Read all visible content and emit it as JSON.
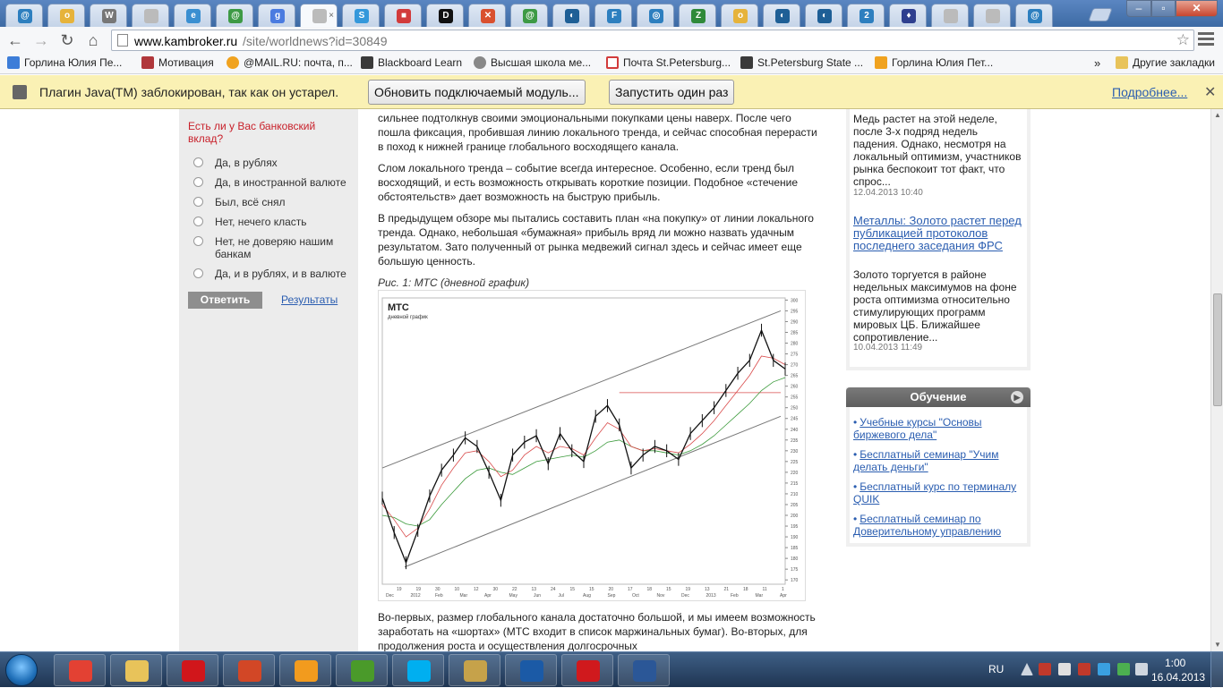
{
  "browser": {
    "url_host": "www.kambroker.ru",
    "url_path": "/site/worldnews?id=30849",
    "tabs": [
      {
        "icon": "tab-icon-1",
        "color": "#2d7fbf",
        "glyph": "@"
      },
      {
        "icon": "tab-icon-2",
        "color": "#e6b33b",
        "glyph": "o"
      },
      {
        "icon": "wikipedia-icon",
        "color": "#777",
        "glyph": "W"
      },
      {
        "icon": "page-icon",
        "color": "#bbb",
        "glyph": ""
      },
      {
        "icon": "tab-icon-5",
        "color": "#3a8fd1",
        "glyph": "e"
      },
      {
        "icon": "tab-icon-6",
        "color": "#3d9a45",
        "glyph": "@"
      },
      {
        "icon": "google-icon",
        "color": "#4a7be0",
        "glyph": "g"
      },
      {
        "icon": "page-icon-active",
        "color": "#bbb",
        "glyph": ""
      },
      {
        "icon": "tab-icon-9",
        "color": "#3498db",
        "glyph": "S"
      },
      {
        "icon": "tab-icon-10",
        "color": "#d23b3b",
        "glyph": "■"
      },
      {
        "icon": "tab-icon-11",
        "color": "#111",
        "glyph": "D"
      },
      {
        "icon": "tab-icon-12",
        "color": "#d9502f",
        "glyph": "✕"
      },
      {
        "icon": "tab-icon-13",
        "color": "#3d9a45",
        "glyph": "@"
      },
      {
        "icon": "tab-icon-14",
        "color": "#1e5f96",
        "glyph": "◐"
      },
      {
        "icon": "tab-icon-15",
        "color": "#2d7fbf",
        "glyph": "F"
      },
      {
        "icon": "tab-icon-16",
        "color": "#2d7fbf",
        "glyph": "◎"
      },
      {
        "icon": "tab-icon-17",
        "color": "#2f8a3a",
        "glyph": "Z"
      },
      {
        "icon": "tab-icon-18",
        "color": "#e6b33b",
        "glyph": "o"
      },
      {
        "icon": "tab-icon-19",
        "color": "#1e5f96",
        "glyph": "◐"
      },
      {
        "icon": "tab-icon-20",
        "color": "#1e5f96",
        "glyph": "◐"
      },
      {
        "icon": "tab-icon-21",
        "color": "#2d7fbf",
        "glyph": "2"
      },
      {
        "icon": "tab-icon-22",
        "color": "#2e3f8f",
        "glyph": "♦"
      },
      {
        "icon": "page-icon",
        "color": "#bbb",
        "glyph": ""
      },
      {
        "icon": "page-icon",
        "color": "#bbb",
        "glyph": ""
      },
      {
        "icon": "tab-icon-25",
        "color": "#2d7fbf",
        "glyph": "@"
      }
    ],
    "bookmarks": [
      {
        "label": "Горлина Юлия Пе...",
        "color": "#3d7dd8"
      },
      {
        "label": "Мотивация",
        "color": "#b0373b"
      },
      {
        "label": "@MAIL.RU: почта, п...",
        "color": "#f0a21f"
      },
      {
        "label": "Blackboard Learn",
        "color": "#3a3a3a"
      },
      {
        "label": "Высшая школа ме...",
        "color": "#888"
      },
      {
        "label": "Почта St.Petersburg...",
        "color": "#d23b3b"
      },
      {
        "label": "St.Petersburg State ...",
        "color": "#3a3a3a"
      },
      {
        "label": "Горлина Юлия Пет...",
        "color": "#f0a21f"
      }
    ],
    "bookmarks_overflow": "»",
    "other_bookmarks": "Другие закладки",
    "infobar": {
      "text": "Плагин Java(TM) заблокирован, так как он устарел.",
      "update_button": "Обновить подключаемый модуль...",
      "run_once_button": "Запустить один раз",
      "more_link": "Подробнее..."
    }
  },
  "poll": {
    "question": "Есть ли у Вас банковский вклад?",
    "options": [
      "Да, в рублях",
      "Да, в иностранной валюте",
      "Был, всё снял",
      "Нет, нечего класть",
      "Нет, не доверяю нашим банкам",
      "Да, и в рублях, и в валюте"
    ],
    "answer_button": "Ответить",
    "results_link": "Результаты"
  },
  "article": {
    "p0": "сильнее подтолкнув своими эмоциональными покупками цены наверх. После чего пошла фиксация, пробившая линию локального тренда, и сейчас способная перерасти в поход к нижней границе глобального восходящего канала.",
    "p1": "Слом локального тренда – событие всегда интересное. Особенно, если тренд был восходящий, и есть возможность открывать короткие позиции. Подобное «стечение обстоятельств» дает возможность на быструю прибыль.",
    "p2": "В предыдущем обзоре мы пытались составить план «на покупку» от линии локального тренда. Однако, небольшая «бумажная» прибыль вряд ли можно назвать удачным результатом. Зато полученный от рынка медвежий сигнал здесь и сейчас имеет еще большую ценность.",
    "figure_caption": "Рис. 1: МТС (дневной график)",
    "p3": "Во-первых, размер глобального канала достаточно большой, и мы имеем возможность заработать на «шортах» (МТС входит в список маржинальных бумаг). Во-вторых, для продолжения роста и осуществления долгосрочных"
  },
  "chart_data": {
    "type": "line",
    "title": "МТС",
    "subtitle": "дневной график",
    "y_ticks": [
      170,
      175,
      180,
      185,
      190,
      195,
      200,
      205,
      210,
      215,
      220,
      225,
      230,
      235,
      240,
      245,
      250,
      255,
      260,
      265,
      270,
      275,
      280,
      285,
      290,
      295,
      300
    ],
    "ylim": [
      168,
      301
    ],
    "x_tick_labels": [
      "19",
      "19",
      "30",
      "10",
      "12",
      "30",
      "22",
      "13",
      "24",
      "15",
      "15",
      "20",
      "17",
      "18",
      "15",
      "19",
      "13",
      "21",
      "18",
      "11",
      "1"
    ],
    "x_month_labels": [
      "Dec",
      "2012",
      "Feb",
      "Mar",
      "Apr",
      "May",
      "Jun",
      "Jul",
      "Aug",
      "Sep",
      "Oct",
      "Nov",
      "Dec",
      "2013",
      "Feb",
      "Mar",
      "Apr"
    ],
    "series": [
      {
        "values": [
          208,
          192,
          178,
          193,
          209,
          221,
          228,
          236,
          232,
          220,
          207,
          228,
          234,
          237,
          224,
          238,
          230,
          225,
          246,
          251,
          242,
          222,
          228,
          232,
          230,
          226,
          238,
          244,
          250,
          258,
          266,
          272,
          286,
          272,
          268
        ],
        "color": "#111"
      },
      {
        "values": [
          205,
          198,
          190,
          194,
          203,
          214,
          222,
          229,
          230,
          225,
          218,
          221,
          228,
          232,
          229,
          232,
          231,
          228,
          236,
          243,
          240,
          232,
          230,
          231,
          230,
          229,
          233,
          238,
          244,
          251,
          258,
          265,
          274,
          273,
          270
        ],
        "color": "#d94b4b"
      },
      {
        "values": [
          200,
          199,
          196,
          195,
          198,
          205,
          211,
          217,
          221,
          222,
          220,
          219,
          222,
          225,
          226,
          227,
          228,
          227,
          230,
          234,
          235,
          232,
          230,
          230,
          229,
          228,
          230,
          233,
          237,
          242,
          247,
          252,
          258,
          262,
          264
        ],
        "color": "#3a9a3a"
      }
    ],
    "horizontal_level": 257,
    "channel": {
      "upper_start": 222,
      "upper_end": 295,
      "lower_start": 176,
      "lower_end": 246
    }
  },
  "news": {
    "snippet1": "Медь растет на этой неделе, после 3-х подряд недель падения. Однако, несмотря на локальный оптимизм, участников рынка беспокоит тот факт, что спрос...",
    "date1": "12.04.2013 10:40",
    "title2": "Металлы: Золото растет перед публикацией протоколов последнего заседания ФРС",
    "snippet2": "Золото торгуется в районе недельных максимумов на фоне роста оптимизма относительно стимулирующих программ мировых ЦБ. Ближайшее сопротивление...",
    "date2": "10.04.2013 11:49"
  },
  "education": {
    "title": "Обучение",
    "items": [
      "Учебные курсы \"Основы биржевого дела\"",
      "Бесплатный семинар \"Учим делать деньги\"",
      "Бесплатный курс по терминалу QUIK",
      "Бесплатный семинар по Доверительному управлению"
    ]
  },
  "taskbar": {
    "apps": [
      {
        "name": "chrome-icon",
        "color": "#e34133"
      },
      {
        "name": "explorer-icon",
        "color": "#e8c35a"
      },
      {
        "name": "opera-icon",
        "color": "#d1161b"
      },
      {
        "name": "powerpoint-icon",
        "color": "#d24726"
      },
      {
        "name": "media-player-icon",
        "color": "#f29b1e"
      },
      {
        "name": "utorrent-icon",
        "color": "#4a9a2a"
      },
      {
        "name": "skype-icon",
        "color": "#00aff0"
      },
      {
        "name": "tool-icon",
        "color": "#c6a24a"
      },
      {
        "name": "alor-icon",
        "color": "#1b5aa6"
      },
      {
        "name": "avira-icon",
        "color": "#d0191d"
      },
      {
        "name": "word-icon",
        "color": "#2b5797"
      }
    ],
    "lang": "RU",
    "time": "1:00",
    "date": "16.04.2013"
  }
}
